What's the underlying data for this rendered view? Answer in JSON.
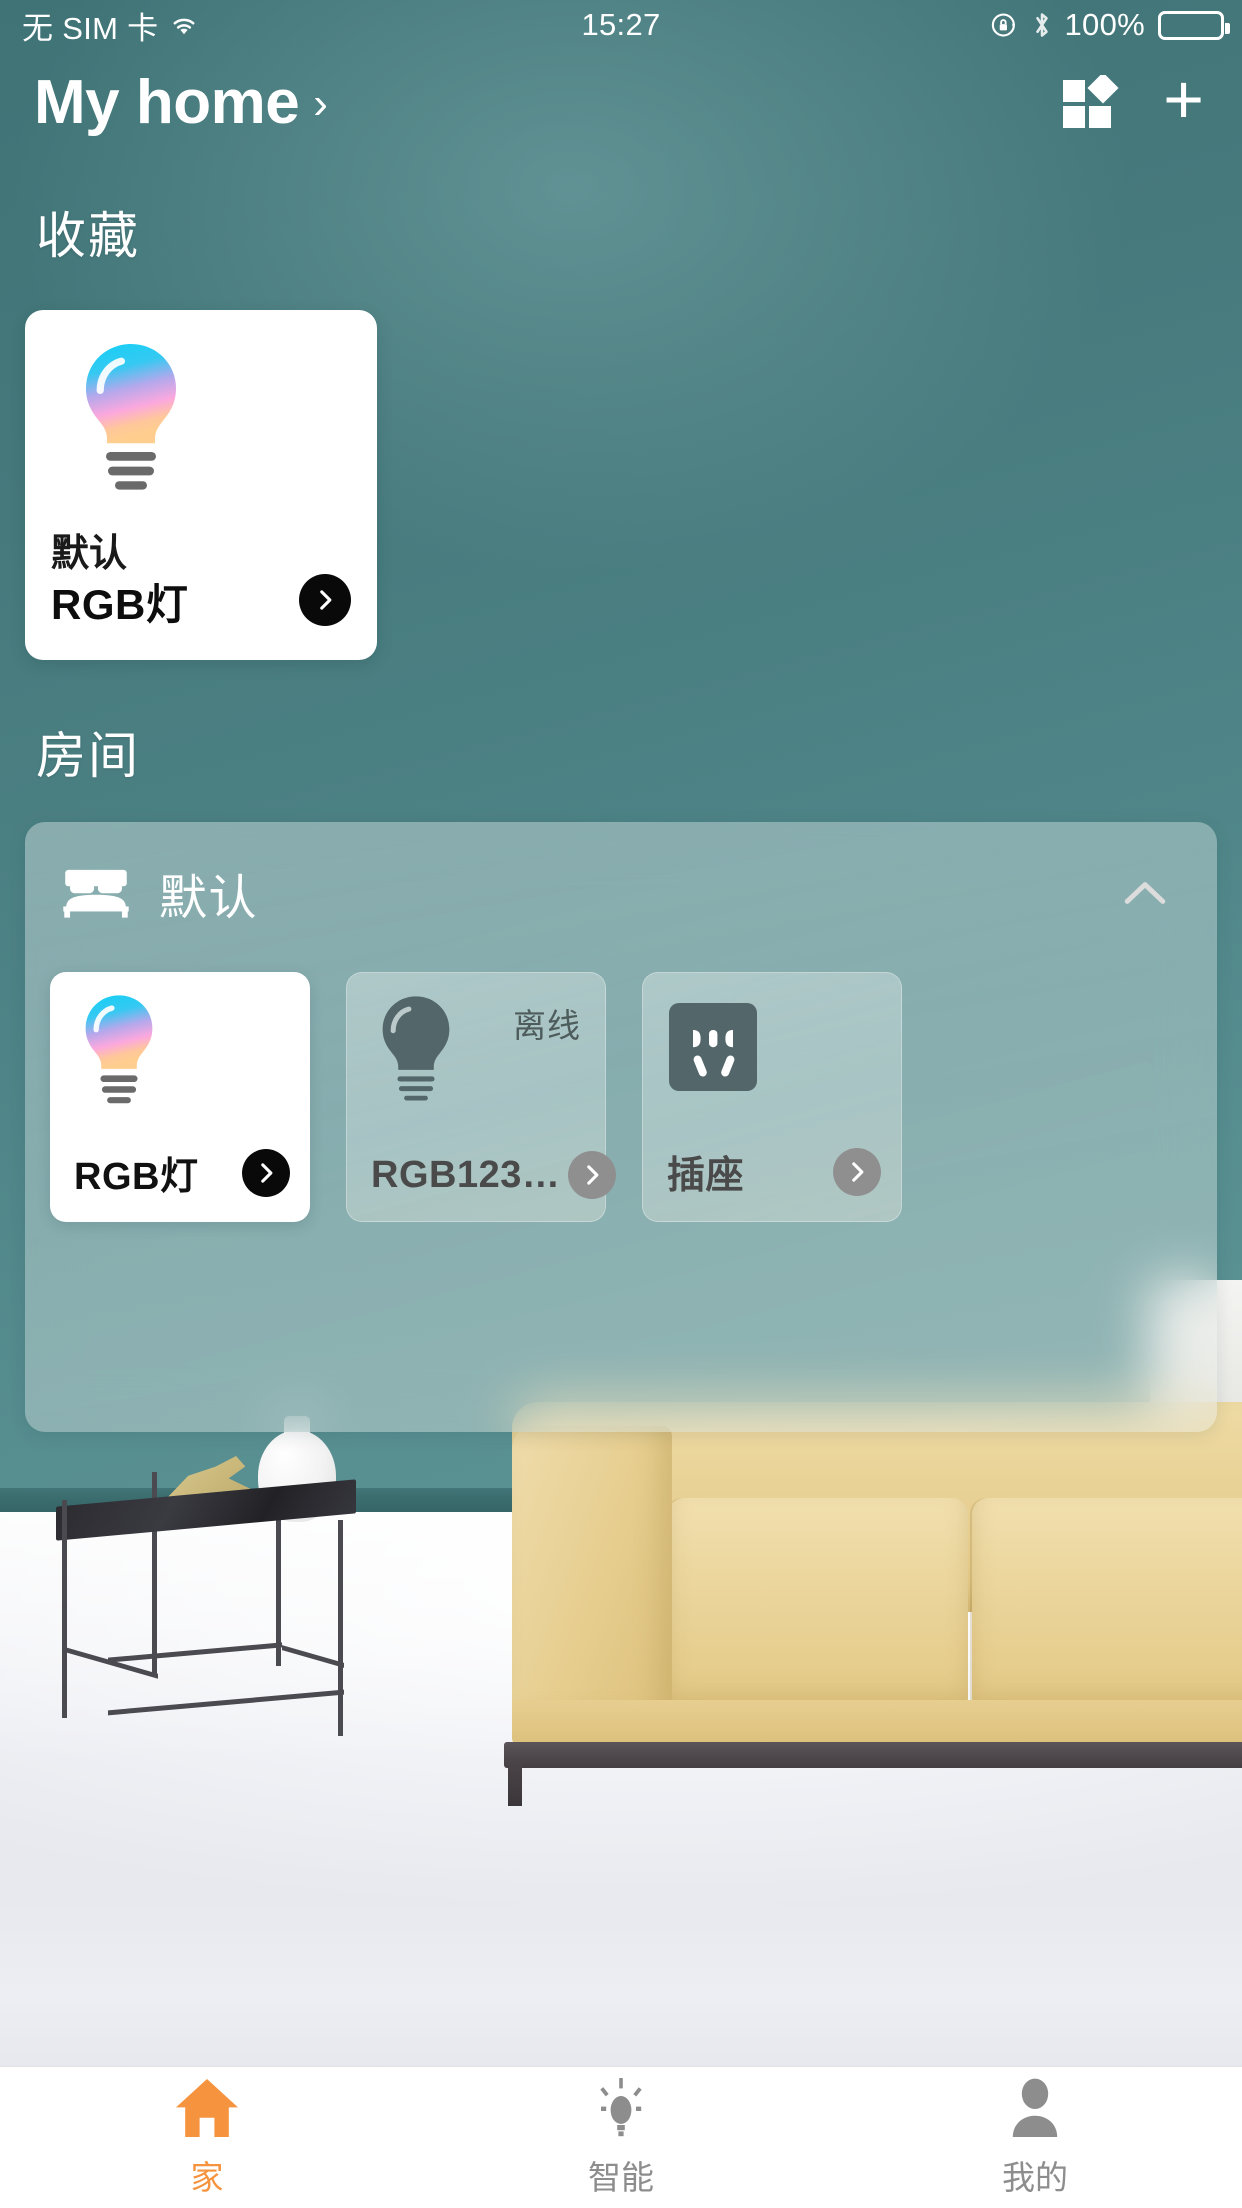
{
  "status_bar": {
    "carrier": "无 SIM 卡",
    "wifi_icon": "wifi-icon",
    "time": "15:27",
    "rotation_lock_icon": "rotation-lock-icon",
    "bluetooth_icon": "bluetooth-icon",
    "battery_percent": "100%",
    "battery_icon": "battery-full-icon"
  },
  "header": {
    "home_name": "My home",
    "chevron": "›",
    "grid_icon": "grid-layout-icon",
    "add_icon": "plus-icon",
    "add_label": "+"
  },
  "favorites": {
    "section_title": "收藏",
    "card": {
      "device_icon": "color-bulb-icon",
      "room": "默认",
      "name": "RGB灯",
      "arrow_icon": "chevron-right-icon",
      "state": "on"
    }
  },
  "rooms": {
    "section_title": "房间",
    "panels": [
      {
        "icon": "bed-icon",
        "name": "默认",
        "collapse_icon": "chevron-up-icon",
        "expanded": true,
        "devices": [
          {
            "icon": "color-bulb-icon",
            "label": "RGB灯",
            "status": "",
            "state": "on",
            "arrow_icon": "chevron-right-icon"
          },
          {
            "icon": "bulb-offline-icon",
            "label": "RGB123…",
            "status": "离线",
            "state": "offline",
            "arrow_icon": "chevron-right-icon"
          },
          {
            "icon": "socket-icon",
            "label": "插座",
            "status": "",
            "state": "offline",
            "arrow_icon": "chevron-right-icon"
          }
        ]
      }
    ]
  },
  "tabbar": {
    "items": [
      {
        "icon": "home-icon",
        "label": "家",
        "active": true
      },
      {
        "icon": "bulb-icon",
        "label": "智能",
        "active": false
      },
      {
        "icon": "person-icon",
        "label": "我的",
        "active": false
      }
    ]
  },
  "colors": {
    "accent": "#F5933F",
    "wall_teal": "#477C80",
    "card_white": "#FFFFFF",
    "arrow_dark": "#090909",
    "arrow_grey": "#8F8F8F",
    "offline_text": "#4E5C5C"
  }
}
